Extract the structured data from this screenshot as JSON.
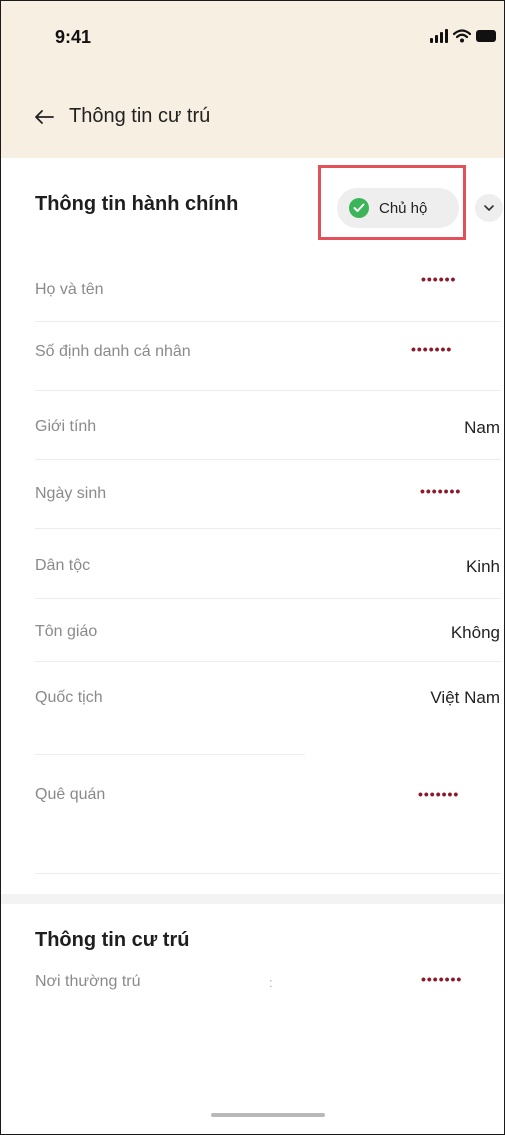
{
  "status_bar": {
    "time": "9:41"
  },
  "header": {
    "title": "Thông tin cư trú"
  },
  "admin_section": {
    "title": "Thông tin hành chính",
    "badge_label": "Chủ hộ",
    "fields": [
      {
        "label": "Họ và tên",
        "value": "••••••",
        "masked": true
      },
      {
        "label": "Số định danh cá nhân",
        "value": "•••••••",
        "masked": true
      },
      {
        "label": "Giới tính",
        "value": "Nam",
        "masked": false
      },
      {
        "label": "Ngày sinh",
        "value": "•••••••",
        "masked": true
      },
      {
        "label": "Dân tộc",
        "value": "Kinh",
        "masked": false
      },
      {
        "label": "Tôn giáo",
        "value": "Không",
        "masked": false
      },
      {
        "label": "Quốc tịch",
        "value": "Việt Nam",
        "masked": false
      },
      {
        "label": "Quê quán",
        "value": "•••••••",
        "masked": true
      }
    ]
  },
  "residence_section": {
    "title": "Thông tin cư trú",
    "fields": [
      {
        "label": "Nơi thường trú",
        "value": "•••••••",
        "masked": true,
        "separator": ":"
      }
    ]
  },
  "colors": {
    "header_bg": "#f7efe1",
    "mask_dots": "#8c1a2a",
    "badge_check": "#3cb55a",
    "highlight": "#e2505a"
  },
  "icons": [
    "back-arrow-icon",
    "check-circle-icon",
    "chevron-down-icon",
    "signal-icon",
    "wifi-icon",
    "battery-icon"
  ]
}
